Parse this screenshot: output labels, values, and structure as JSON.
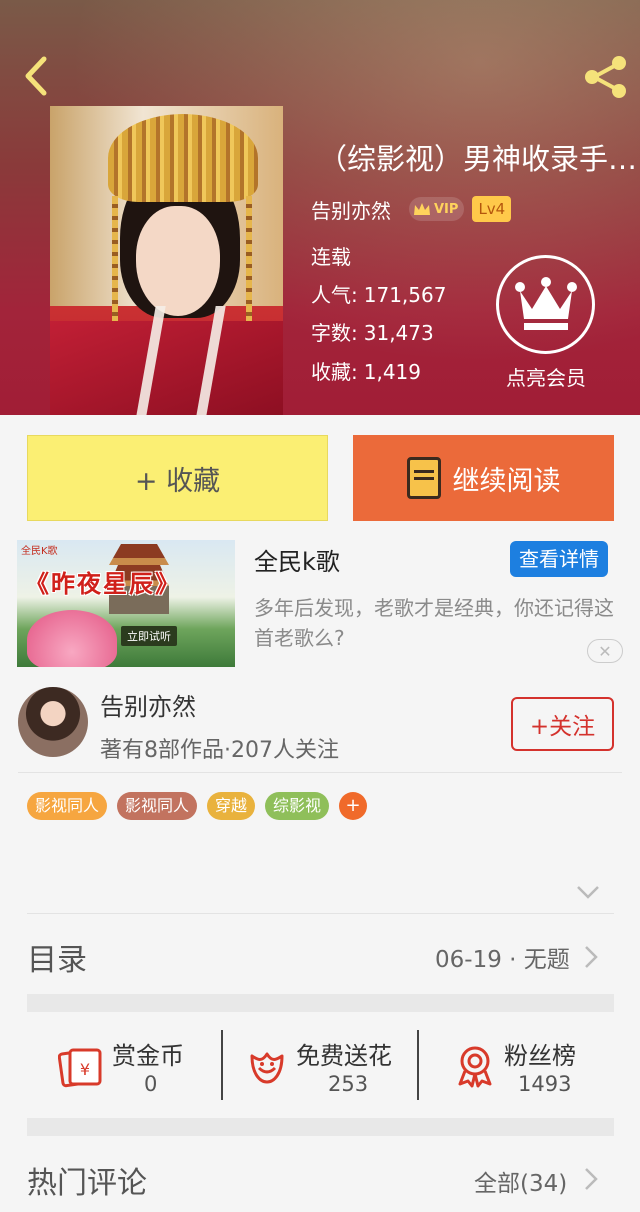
{
  "book": {
    "title": "（综影视）男神收录手…",
    "author": "告别亦然",
    "vip_label": "VIP",
    "level": "Lv4",
    "status": "连载",
    "popularity_label": "人气:",
    "popularity": "171,567",
    "word_count_label": "字数:",
    "word_count": "31,473",
    "favorites_label": "收藏:",
    "favorites": "1,419",
    "vip_member_label": "点亮会员"
  },
  "actions": {
    "collect_label": "+ 收藏",
    "read_label": "继续阅读"
  },
  "ad": {
    "image_title": "《昨夜星辰》",
    "image_logo": "全民K歌",
    "image_button": "立即试听",
    "brand": "全民k歌",
    "detail_button": "查看详情",
    "description": "多年后发现，老歌才是经典，你还记得这首老歌么?",
    "close_label": "✕"
  },
  "author_card": {
    "name": "告别亦然",
    "meta": "著有8部作品·207人关注",
    "follow_label": "+关注"
  },
  "tags": [
    {
      "label": "影视同人",
      "color": "#f6a640"
    },
    {
      "label": "影视同人",
      "color": "#c2735f"
    },
    {
      "label": "穿越",
      "color": "#e9b23d"
    },
    {
      "label": "综影视",
      "color": "#8fbf5a"
    }
  ],
  "tags_more": "+",
  "toc": {
    "label": "目录",
    "latest": "06-19 · 无题"
  },
  "stats": [
    {
      "title": "赏金币",
      "value": "0",
      "icon": "coin-envelope-icon"
    },
    {
      "title": "免费送花",
      "value": "253",
      "icon": "flower-icon"
    },
    {
      "title": "粉丝榜",
      "value": "1493",
      "icon": "medal-icon"
    }
  ],
  "comments": {
    "label": "热门评论",
    "all_label": "全部(34)"
  },
  "colors": {
    "accent_orange": "#eb6a3a",
    "collect_yellow": "#fbef73",
    "follow_red": "#d4322d",
    "detail_blue": "#1d7fe0"
  }
}
